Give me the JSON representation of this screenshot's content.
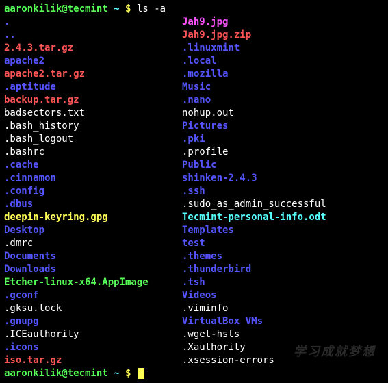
{
  "prompt": {
    "user_host": "aaronkilik@tecmint",
    "cwd": "~",
    "symbol": "$",
    "command": "ls -a"
  },
  "listing": {
    "col1": [
      {
        "name": ".",
        "cls": "c-dir"
      },
      {
        "name": "..",
        "cls": "c-dir"
      },
      {
        "name": "2.4.3.tar.gz",
        "cls": "c-arch"
      },
      {
        "name": "apache2",
        "cls": "c-dir"
      },
      {
        "name": "apache2.tar.gz",
        "cls": "c-arch"
      },
      {
        "name": ".aptitude",
        "cls": "c-dir"
      },
      {
        "name": "backup.tar.gz",
        "cls": "c-arch"
      },
      {
        "name": "badsectors.txt",
        "cls": "c-file"
      },
      {
        "name": ".bash_history",
        "cls": "c-file"
      },
      {
        "name": ".bash_logout",
        "cls": "c-file"
      },
      {
        "name": ".bashrc",
        "cls": "c-file"
      },
      {
        "name": ".cache",
        "cls": "c-dir"
      },
      {
        "name": ".cinnamon",
        "cls": "c-dir"
      },
      {
        "name": ".config",
        "cls": "c-dir"
      },
      {
        "name": ".dbus",
        "cls": "c-dir"
      },
      {
        "name": "deepin-keyring.gpg",
        "cls": "c-spec"
      },
      {
        "name": "Desktop",
        "cls": "c-dir"
      },
      {
        "name": ".dmrc",
        "cls": "c-file"
      },
      {
        "name": "Documents",
        "cls": "c-dir"
      },
      {
        "name": "Downloads",
        "cls": "c-dir"
      },
      {
        "name": "Etcher-linux-x64.AppImage",
        "cls": "c-exec"
      },
      {
        "name": ".gconf",
        "cls": "c-dir"
      },
      {
        "name": ".gksu.lock",
        "cls": "c-file"
      },
      {
        "name": ".gnupg",
        "cls": "c-dir"
      },
      {
        "name": ".ICEauthority",
        "cls": "c-file"
      },
      {
        "name": ".icons",
        "cls": "c-dir"
      },
      {
        "name": "iso.tar.gz",
        "cls": "c-arch"
      }
    ],
    "col2": [
      {
        "name": "Jah9.jpg",
        "cls": "c-img"
      },
      {
        "name": "Jah9.jpg.zip",
        "cls": "c-arch"
      },
      {
        "name": ".linuxmint",
        "cls": "c-dir"
      },
      {
        "name": ".local",
        "cls": "c-dir"
      },
      {
        "name": ".mozilla",
        "cls": "c-dir"
      },
      {
        "name": "Music",
        "cls": "c-dir"
      },
      {
        "name": ".nano",
        "cls": "c-dir"
      },
      {
        "name": "nohup.out",
        "cls": "c-file"
      },
      {
        "name": "Pictures",
        "cls": "c-dir"
      },
      {
        "name": ".pki",
        "cls": "c-dir"
      },
      {
        "name": ".profile",
        "cls": "c-file"
      },
      {
        "name": "Public",
        "cls": "c-dir"
      },
      {
        "name": "shinken-2.4.3",
        "cls": "c-dir"
      },
      {
        "name": ".ssh",
        "cls": "c-dir"
      },
      {
        "name": ".sudo_as_admin_successful",
        "cls": "c-file"
      },
      {
        "name": "Tecmint-personal-info.odt",
        "cls": "c-link"
      },
      {
        "name": "Templates",
        "cls": "c-dir"
      },
      {
        "name": "test",
        "cls": "c-dir"
      },
      {
        "name": ".themes",
        "cls": "c-dir"
      },
      {
        "name": ".thunderbird",
        "cls": "c-dir"
      },
      {
        "name": ".tsh",
        "cls": "c-dir"
      },
      {
        "name": "Videos",
        "cls": "c-dir"
      },
      {
        "name": ".viminfo",
        "cls": "c-file"
      },
      {
        "name": "VirtualBox VMs",
        "cls": "c-dir"
      },
      {
        "name": ".wget-hsts",
        "cls": "c-file"
      },
      {
        "name": ".Xauthority",
        "cls": "c-file"
      },
      {
        "name": ".xsession-errors",
        "cls": "c-file"
      }
    ]
  },
  "watermark": "学习成就梦想"
}
